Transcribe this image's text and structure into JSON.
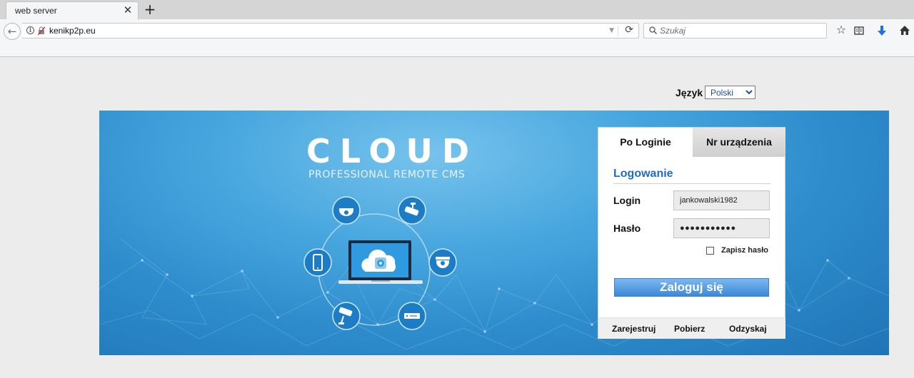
{
  "browser": {
    "tab_title": "web server",
    "url": "kenikp2p.eu",
    "search_placeholder": "Szukaj"
  },
  "page": {
    "language_label": "Język",
    "language_selected": "Polski"
  },
  "banner": {
    "title": "CLOUD",
    "subtitle": "PROFESSIONAL REMOTE CMS"
  },
  "login_panel": {
    "tab_login": "Po Loginie",
    "tab_device": "Nr urządzenia",
    "heading": "Logowanie",
    "login_label": "Login",
    "login_value": "jankowalski1982",
    "password_label": "Hasło",
    "password_value": "●●●●●●●●●●●",
    "remember_label": "Zapisz hasło",
    "submit_label": "Zaloguj się",
    "footer_links": [
      "Zarejestruj",
      "Pobierz",
      "Odzyskaj"
    ]
  }
}
